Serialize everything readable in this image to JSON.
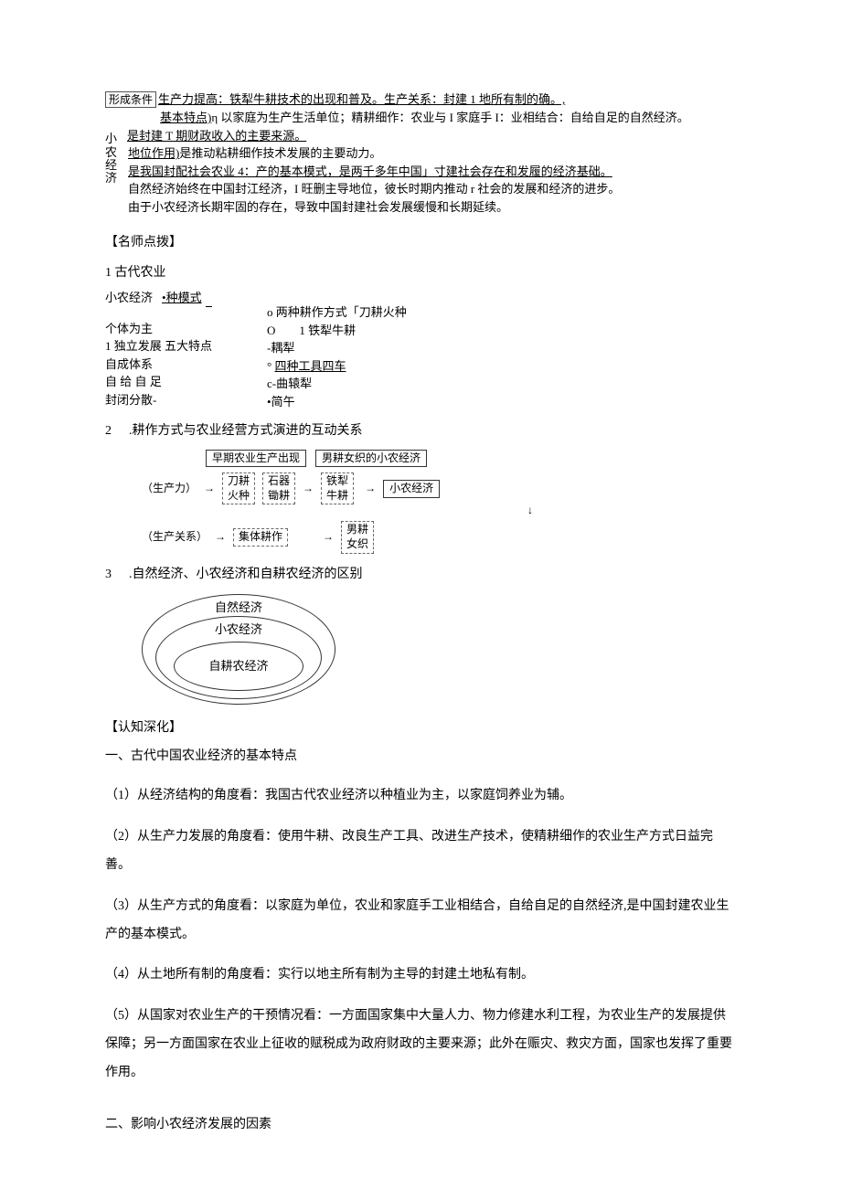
{
  "top_block": {
    "badge1": "形成条件",
    "line1a": "生产力提高：铁犁牛耕技术的出现和普及。生产关系：封建 1 地所有制的确。,",
    "line2_label": "基本特点)",
    "line2_text": "η 以家庭为生产生活单位；精耕细作：农业与 I 家庭手 I：业相结合：自给自足的自然经济。",
    "line3": "是封建 T 期财政收入的主要来源。",
    "line4_label": "地位作用)",
    "line4_text": "是推动粘耕细作技术发展的主要动力。",
    "vertical": [
      "小",
      "农",
      "经",
      "济"
    ],
    "line5": "是我国封配社会农业 4：产的基本模式，是两千多年中国」寸建社会存在和发履的经济基础。",
    "line6": "自然经济始终在中国封江经济，I 旺删主导地位，彼长时期内推动 r 社会的发展和经济的进步。",
    "line7": "由于小农经济长期牢固的存在，导致中国封建社会发展缓慢和长期延续。"
  },
  "tutor": {
    "head": "【名师点拨】",
    "item1": "1 古代农业",
    "left": {
      "r1a": "小农经济",
      "r1b": "•种模式",
      "r2": "个体为主",
      "r3": "1 独立发展 五大特点",
      "r4": "自成体系",
      "r5": "自 给 自 足",
      "r6": "封闭分散-"
    },
    "right": {
      "r1": "o 两种耕作方式「刀耕火种",
      "r2": "O　　1 铁犁牛耕",
      "r3": "-耦犁",
      "r4a": "°",
      "r4b": "四种工具四车",
      "r5": "c-曲辕犁",
      "r6": "•简午"
    }
  },
  "item2": {
    "title": ".耕作方式与农业经营方式演进的互动关系",
    "box1": "早期农业生产出现",
    "box2": "男耕女织的小农经济",
    "lp1": "（生产力）",
    "d1a": "刀耕",
    "d1b": "火种",
    "d2a": "石器",
    "d2b": "锄耕",
    "d3a": "铁犁",
    "d3b": "牛耕",
    "side": "小农经济",
    "lp2": "（生产关系）",
    "d4": "集体耕作",
    "d5a": "男耕",
    "d5b": "女织"
  },
  "item3": {
    "title": ".自然经济、小农经济和自耕农经济的区别",
    "e1": "自然经济",
    "e2": "小农经济",
    "e3": "自耕农经济"
  },
  "deep": {
    "head": "【认知深化】",
    "t1": "一、古代中国农业经济的基本特点",
    "p1": "（1）从经济结构的角度看：我国古代农业经济以种植业为主，以家庭饲养业为辅。",
    "p2": "（2）从生产力发展的角度看：使用牛耕、改良生产工具、改进生产技术，使精耕细作的农业生产方式日益完善。",
    "p3": "（3）从生产方式的角度看：以家庭为单位，农业和家庭手工业相结合，自给自足的自然经济,是中国封建农业生产的基本模式。",
    "p4": "（4）从土地所有制的角度看：实行以地主所有制为主导的封建土地私有制。",
    "p5": "（5）从国家对农业生产的干预情况看：一方面国家集中大量人力、物力修建水利工程，为农业生产的发展提供保障；另一方面国家在农业上征收的赋税成为政府财政的主要来源；此外在赈灾、救灾方面，国家也发挥了重要作用。",
    "t2": "二、影响小农经济发展的因素"
  }
}
